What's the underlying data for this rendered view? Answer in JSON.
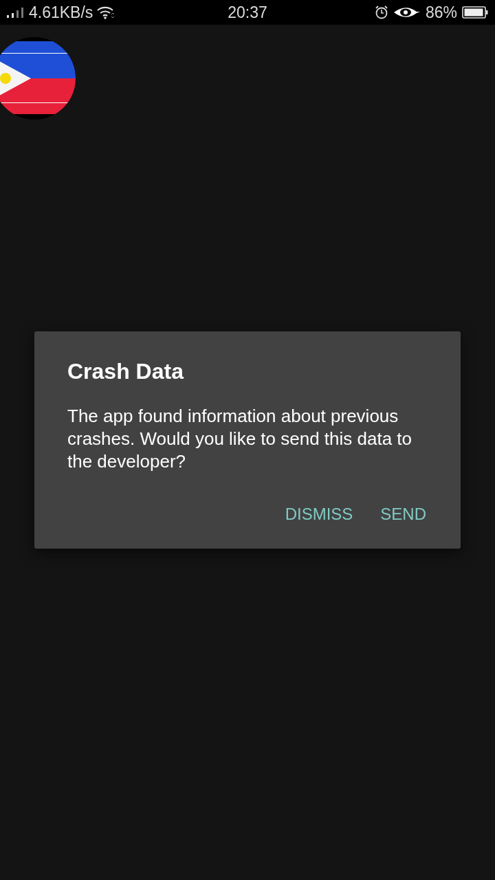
{
  "status_bar": {
    "speed": "4.61KB/s",
    "time": "20:37",
    "battery": "86%"
  },
  "dialog": {
    "title": "Crash Data",
    "message": "The app found information about previous crashes. Would you like to send this data to the developer?",
    "buttons": [
      "DISMISS",
      "SEND"
    ]
  }
}
